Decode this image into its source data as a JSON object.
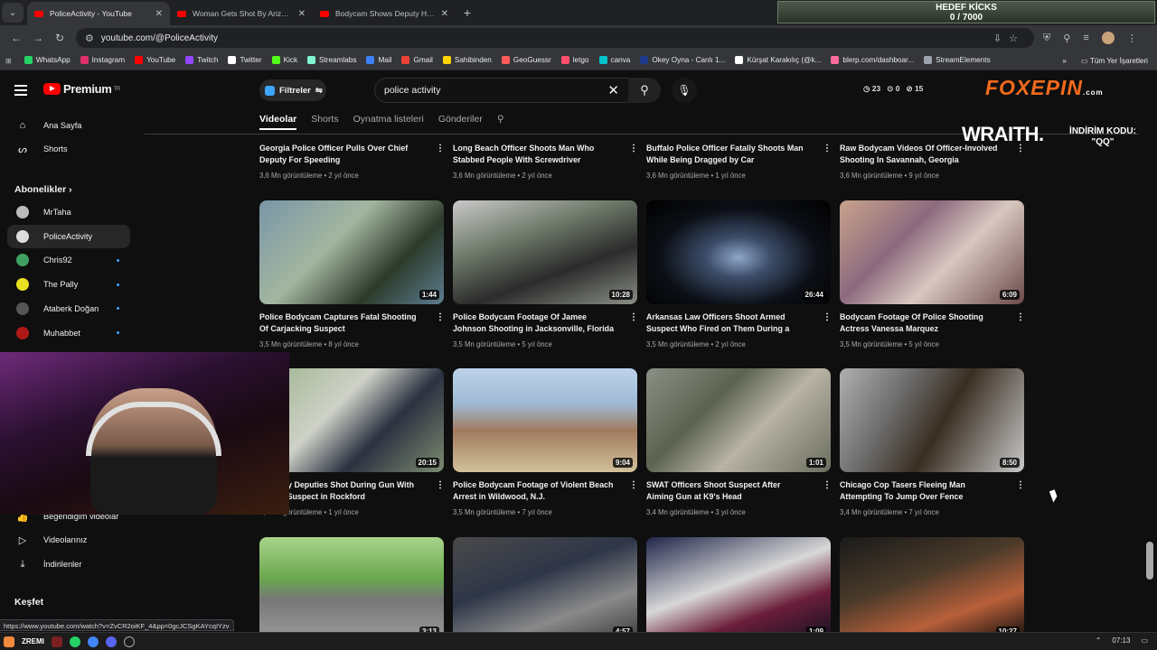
{
  "browser": {
    "tabs": [
      {
        "title": "PoliceActivity - YouTube",
        "active": true
      },
      {
        "title": "Woman Gets Shot By Arizona O",
        "active": false
      },
      {
        "title": "Bodycam Shows Deputy Hanging",
        "active": false
      }
    ],
    "url": "youtube.com/@PoliceActivity",
    "bookmarks": [
      "WhatsApp",
      "Instagram",
      "YouTube",
      "Twitch",
      "Twitter",
      "Kick",
      "Streamlabs",
      "Mail",
      "Gmail",
      "Sahibinden",
      "GeoGuessr",
      "letgo",
      "canva",
      "Okey Oyna - Canlı 1...",
      "Kürşat Karakılıç (@k...",
      "blerp.com/dashboar...",
      "StreamElements"
    ],
    "bookmark_colors": [
      "#25d366",
      "#e1306c",
      "#ff0000",
      "#9146ff",
      "#ffffff",
      "#53fc18",
      "#80f5d2",
      "#3b82f6",
      "#ea4335",
      "#ffd400",
      "#ff5a5a",
      "#ff4f6d",
      "#00c4cc",
      "#1e3a8a",
      "#ffffff",
      "#ff6b9d",
      "#9ca3af"
    ],
    "all_bookmarks": "Tüm Yer İşaretleri",
    "status_url": "https://www.youtube.com/watch?v=ZvCR2oiKF_4&pp=0gcJCSgKAYcqIYzv"
  },
  "overlay": {
    "goal_title": "HEDEF KİCKS",
    "goal_value": "0 / 7000",
    "brand_fox": "FOX",
    "brand_epin": "EPIN",
    "brand_com": ".com",
    "wraith": "WRAITH.",
    "discount_label": "İNDİRİM KODU:",
    "discount_code": "\"QQ\""
  },
  "youtube": {
    "logo_text": "Premium",
    "logo_sup": "TR",
    "filters_label": "Filtreler",
    "search_value": "police activity",
    "stats": [
      "23",
      "0",
      "15"
    ],
    "channel_tabs": [
      "Videolar",
      "Shorts",
      "Oynatma listeleri",
      "Gönderiler"
    ],
    "sidebar": {
      "home": "Ana Sayfa",
      "shorts": "Shorts",
      "subs_header": "Abonelikler",
      "subs": [
        {
          "name": "MrTaha",
          "color": "#bbbbbb",
          "new": false
        },
        {
          "name": "PoliceActivity",
          "color": "#dddddd",
          "new": false
        },
        {
          "name": "Chris92",
          "color": "#3fa060",
          "new": true
        },
        {
          "name": "The Pally",
          "color": "#e8e020",
          "new": true
        },
        {
          "name": "Ataberk Doğan",
          "color": "#555555",
          "new": true
        },
        {
          "name": "Muhabbet",
          "color": "#b01818",
          "new": true
        }
      ],
      "liked": "Beğendiğim videolar",
      "your_videos": "Videolarınız",
      "downloads": "İndirilenler",
      "explore": "Keşfet"
    },
    "rows": [
      [
        {
          "title": "Georgia Police Officer Pulls Over Chief Deputy For Speeding",
          "meta": "3,6 Mn görüntüleme • 2 yıl önce"
        },
        {
          "title": "Long Beach Officer Shoots Man Who Stabbed People With Screwdriver",
          "meta": "3,6 Mn görüntüleme • 2 yıl önce"
        },
        {
          "title": "Buffalo Police Officer Fatally Shoots Man While Being Dragged by Car",
          "meta": "3,6 Mn görüntüleme • 1 yıl önce"
        },
        {
          "title": "Raw Bodycam Videos Of Officer-Involved Shooting In Savannah, Georgia",
          "meta": "3,6 Mn görüntüleme • 9 yıl önce"
        }
      ],
      [
        {
          "title": "Police Bodycam Captures Fatal Shooting Of Carjacking Suspect",
          "meta": "3,5 Mn görüntüleme • 8 yıl önce",
          "dur": "1:44",
          "bg": "linear-gradient(135deg,#7a96a8 0%,#a3b6a0 40%,#2c3a2a 70%,#5d7d92 100%)"
        },
        {
          "title": "Police Bodycam Footage Of Jamee Johnson Shooting in Jacksonville, Florida",
          "meta": "3,5 Mn görüntüleme • 5 yıl önce",
          "dur": "10:28",
          "bg": "linear-gradient(160deg,#c9c9c9 0%,#6f7a6a 35%,#2b2b2b 65%,#8a8f86 100%)"
        },
        {
          "title": "Arkansas Law Officers Shoot Armed Suspect Who Fired on Them During a Wild...",
          "meta": "3,5 Mn görüntüleme • 2 yıl önce",
          "dur": "26:44",
          "bg": "radial-gradient(ellipse at 50% 55%,#8fa6c8 0%,#3c4d6a 25%,#0c0f16 60%,#000 100%)"
        },
        {
          "title": "Bodycam Footage Of Police Shooting Actress Vanessa Marquez",
          "meta": "3,5 Mn görüntüleme • 5 yıl önce",
          "dur": "6:09",
          "bg": "linear-gradient(135deg,#c9a38c 0%,#8c6a7e 35%,#d8c7c0 60%,#6b4a4a 100%)"
        }
      ],
      [
        {
          "title": "t County Deputies Shot During Gun With Armed Suspect in Rockford",
          "meta": "3,5 Mn görüntüleme • 1 yıl önce",
          "dur": "20:15",
          "bg": "linear-gradient(135deg,#9bb28a 0%,#cfd2c8 40%,#2a3140 65%,#7c8a70 100%)"
        },
        {
          "title": "Police Bodycam Footage of Violent Beach Arrest in Wildwood, N.J.",
          "meta": "3,5 Mn görüntüleme • 7 yıl önce",
          "dur": "9:04",
          "bg": "linear-gradient(180deg,#bcd3ea 0%,#9fb8d3 35%,#a27a5e 60%,#d2c19b 100%)"
        },
        {
          "title": "SWAT Officers Shoot Suspect After Aiming Gun at K9's Head",
          "meta": "3,4 Mn görüntüleme • 3 yıl önce",
          "dur": "1:01",
          "bg": "linear-gradient(135deg,#8b8f85 0%,#5c6350 35%,#b8b3a5 60%,#6b6d5e 100%)"
        },
        {
          "title": "Chicago Cop Tasers Fleeing Man Attempting To Jump Over Fence",
          "meta": "3,4 Mn görüntüleme • 7 yıl önce",
          "dur": "8:50",
          "bg": "linear-gradient(120deg,#b0b0b0 0%,#6e6e6e 30%,#3a2e22 55%,#c8c8c8 100%)"
        }
      ],
      [
        {
          "dur": "3:13",
          "bg": "linear-gradient(180deg,#a8d38a 0%,#6aa84f 40%,#777 60%,#9a9a9a 100%)"
        },
        {
          "dur": "4:57",
          "bg": "linear-gradient(160deg,#4a4a4a 0%,#2e3648 40%,#8a8a8a 70%,#3a3a3a 100%)"
        },
        {
          "dur": "1:09",
          "bg": "linear-gradient(160deg,#20264a 0%,#d8d8d8 45%,#6b1e3a 70%,#101020 100%)"
        },
        {
          "dur": "10:27",
          "bg": "linear-gradient(160deg,#1a1a1a 0%,#4a3a2a 40%,#b8603a 70%,#0a0a0a 100%)"
        }
      ]
    ]
  },
  "taskbar": {
    "time": "07:13",
    "start_label": "ZREMI"
  }
}
